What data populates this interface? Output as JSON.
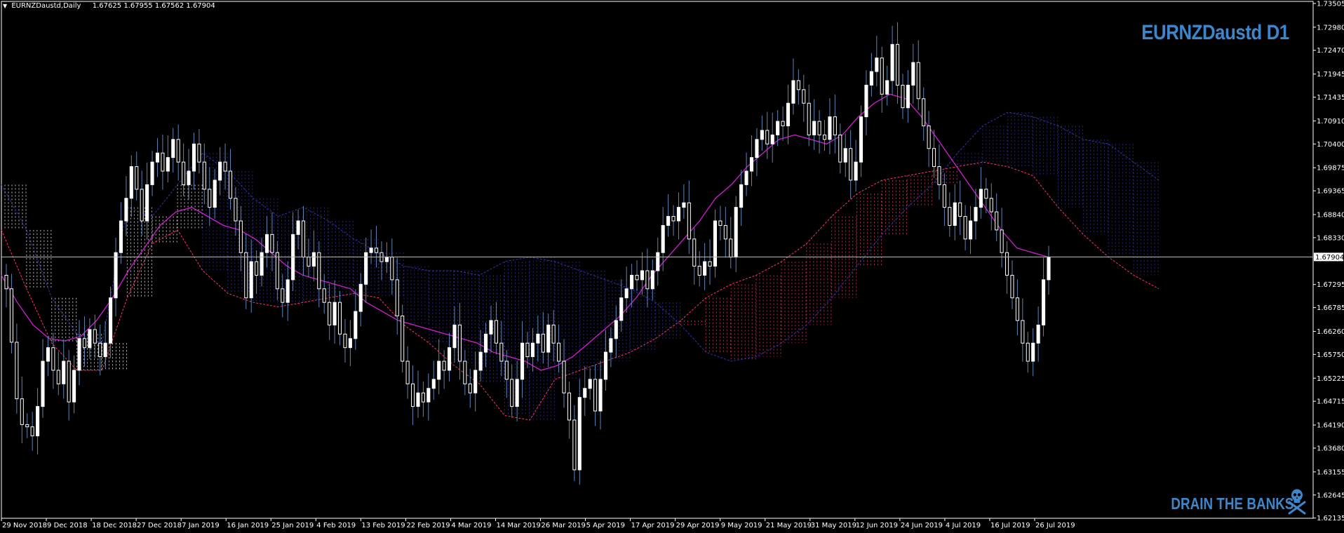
{
  "header": {
    "symbol": "EURNZDaustd,Daily",
    "ohlc": [
      "1.67625",
      "1.67955",
      "1.67562",
      "1.67904"
    ]
  },
  "title": "EURNZDaustd D1",
  "brand": "DRAIN THE BANKS",
  "icons": {
    "menu": "triangle-down-icon",
    "brand": "skull-crossbones-icon"
  },
  "colors": {
    "background": "#000000",
    "frame": "#ffffff",
    "candle_bull": "#ffffff",
    "candle_bear": "#ffffff",
    "wick": "#5b86b8",
    "ma": "#d21ed2",
    "cloud_bull": "#ff3366",
    "cloud_bear": "#3333aa",
    "cloud_white": "#ffffff",
    "price_line": "#c0c0c0",
    "title": "#3e86c9"
  },
  "chart_data": {
    "type": "candlestick",
    "ylim": [
      1.6213,
      1.7355
    ],
    "yticks": [
      "1.73505",
      "1.72980",
      "1.72470",
      "1.71945",
      "1.71435",
      "1.70910",
      "1.70400",
      "1.69875",
      "1.69365",
      "1.68840",
      "1.68330",
      "1.67820",
      "1.67295",
      "1.66785",
      "1.66260",
      "1.65750",
      "1.65225",
      "1.64715",
      "1.64190",
      "1.63680",
      "1.63155",
      "1.62645",
      "1.62135"
    ],
    "xticks": [
      "29 Nov 2018",
      "9 Dec 2018",
      "18 Dec 2018",
      "27 Dec 2018",
      "7 Jan 2019",
      "16 Jan 2019",
      "25 Jan 2019",
      "4 Feb 2019",
      "13 Feb 2019",
      "22 Feb 2019",
      "4 Mar 2019",
      "14 Mar 2019",
      "26 Mar 2019",
      "5 Apr 2019",
      "17 Apr 2019",
      "29 Apr 2019",
      "9 May 2019",
      "21 May 2019",
      "31 May 2019",
      "12 Jun 2019",
      "24 Jun 2019",
      "4 Jul 2019",
      "16 Jul 2019",
      "26 Jul 2019"
    ],
    "current_price": "1.67904",
    "closes": [
      1.672,
      1.6602,
      1.6477,
      1.642,
      1.6415,
      1.6395,
      1.646,
      1.656,
      1.659,
      1.654,
      1.651,
      1.656,
      1.647,
      1.654,
      1.661,
      1.659,
      1.663,
      1.66,
      1.657,
      1.66,
      1.67,
      1.68,
      1.687,
      1.692,
      1.699,
      1.694,
      1.687,
      1.695,
      1.7,
      1.702,
      1.698,
      1.701,
      1.705,
      1.7,
      1.695,
      1.698,
      1.704,
      1.7,
      1.694,
      1.69,
      1.696,
      1.7,
      1.698,
      1.692,
      1.687,
      1.68,
      1.67,
      1.678,
      1.675,
      1.68,
      1.684,
      1.68,
      1.672,
      1.669,
      1.674,
      1.684,
      1.687,
      1.679,
      1.677,
      1.68,
      1.672,
      1.669,
      1.664,
      1.669,
      1.662,
      1.659,
      1.661,
      1.667,
      1.673,
      1.68,
      1.681,
      1.68,
      1.678,
      1.679,
      1.674,
      1.666,
      1.656,
      1.651,
      1.646,
      1.649,
      1.647,
      1.65,
      1.652,
      1.656,
      1.654,
      1.659,
      1.664,
      1.656,
      1.651,
      1.649,
      1.654,
      1.658,
      1.662,
      1.665,
      1.66,
      1.656,
      1.652,
      1.646,
      1.652,
      1.66,
      1.657,
      1.66,
      1.662,
      1.658,
      1.664,
      1.66,
      1.656,
      1.649,
      1.643,
      1.632,
      1.648,
      1.65,
      1.652,
      1.645,
      1.652,
      1.658,
      1.661,
      1.665,
      1.67,
      1.672,
      1.675,
      1.674,
      1.676,
      1.672,
      1.676,
      1.68,
      1.686,
      1.688,
      1.687,
      1.69,
      1.691,
      1.683,
      1.677,
      1.675,
      1.678,
      1.677,
      1.687,
      1.686,
      1.683,
      1.679,
      1.69,
      1.695,
      1.698,
      1.701,
      1.705,
      1.707,
      1.704,
      1.706,
      1.709,
      1.708,
      1.713,
      1.718,
      1.716,
      1.713,
      1.706,
      1.709,
      1.706,
      1.705,
      1.71,
      1.706,
      1.7,
      1.703,
      1.696,
      1.7,
      1.71,
      1.717,
      1.72,
      1.723,
      1.715,
      1.718,
      1.726,
      1.717,
      1.712,
      1.717,
      1.722,
      1.714,
      1.708,
      1.703,
      1.699,
      1.695,
      1.69,
      1.686,
      1.691,
      1.688,
      1.683,
      1.687,
      1.69,
      1.694,
      1.692,
      1.689,
      1.685,
      1.68,
      1.675,
      1.67,
      1.665,
      1.66,
      1.656,
      1.66,
      1.664,
      1.674,
      1.679
    ],
    "ma": [
      1.675,
      1.669,
      1.664,
      1.661,
      1.6605,
      1.6615,
      1.665,
      1.67,
      1.676,
      1.681,
      1.686,
      1.689,
      1.69,
      1.688,
      1.686,
      1.685,
      1.683,
      1.68,
      1.677,
      1.675,
      1.674,
      1.673,
      1.672,
      1.669,
      1.667,
      1.665,
      1.664,
      1.663,
      1.662,
      1.661,
      1.66,
      1.658,
      1.657,
      1.656,
      1.654,
      1.655,
      1.657,
      1.66,
      1.663,
      1.666,
      1.67,
      1.675,
      1.679,
      1.683,
      1.687,
      1.692,
      1.695,
      1.699,
      1.702,
      1.705,
      1.706,
      1.705,
      1.704,
      1.706,
      1.71,
      1.713,
      1.715,
      1.714,
      1.71,
      1.705,
      1.7,
      1.695,
      1.69,
      1.685,
      1.681,
      1.68,
      1.679
    ],
    "cloud_upper": [
      1.695,
      1.685,
      1.67,
      1.662,
      1.66,
      1.69,
      1.688,
      1.695,
      1.702,
      1.698,
      1.692,
      1.688,
      1.69,
      1.687,
      1.683,
      1.68,
      1.677,
      1.676,
      1.676,
      1.675,
      1.678,
      1.679,
      1.678,
      1.676,
      1.674,
      1.672,
      1.669,
      1.664,
      1.658,
      1.656,
      1.657,
      1.66,
      1.664,
      1.67,
      1.677,
      1.684,
      1.69,
      1.695,
      1.702,
      1.708,
      1.711,
      1.71,
      1.708,
      1.705,
      1.704,
      1.7,
      1.696
    ],
    "cloud_lower": [
      1.685,
      1.672,
      1.66,
      1.654,
      1.654,
      1.67,
      1.682,
      1.685,
      1.676,
      1.671,
      1.669,
      1.668,
      1.669,
      1.67,
      1.671,
      1.67,
      1.664,
      1.66,
      1.655,
      1.651,
      1.644,
      1.643,
      1.652,
      1.654,
      1.656,
      1.658,
      1.661,
      1.665,
      1.67,
      1.673,
      1.675,
      1.678,
      1.682,
      1.688,
      1.693,
      1.696,
      1.697,
      1.698,
      1.699,
      1.7,
      1.699,
      1.697,
      1.69,
      1.684,
      1.679,
      1.675,
      1.672
    ]
  }
}
